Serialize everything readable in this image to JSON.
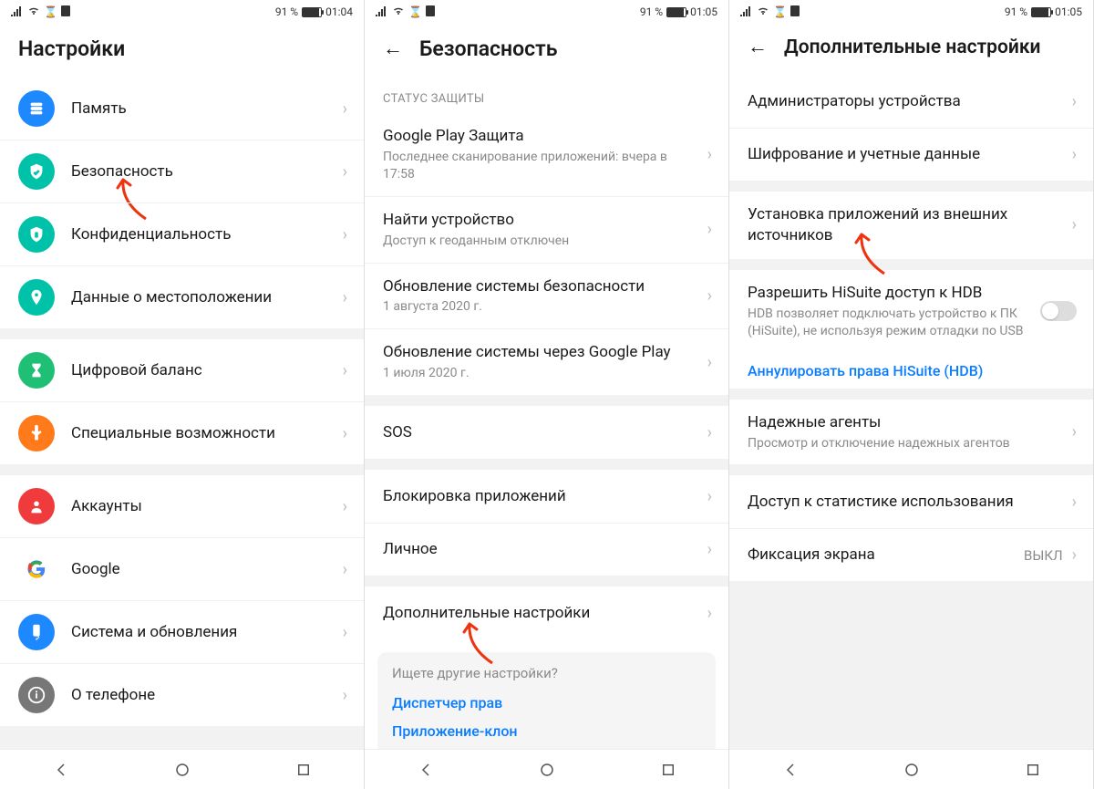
{
  "status": {
    "battery_pct": "91 %",
    "t0": "01:04",
    "t1": "01:05",
    "t2": "01:05"
  },
  "screen1": {
    "title": "Настройки",
    "items": [
      {
        "label": "Память"
      },
      {
        "label": "Безопасность"
      },
      {
        "label": "Конфиденциальность"
      },
      {
        "label": "Данные о местоположении"
      },
      {
        "label": "Цифровой баланс"
      },
      {
        "label": "Специальные возможности"
      },
      {
        "label": "Аккаунты"
      },
      {
        "label": "Google"
      },
      {
        "label": "Система и обновления"
      },
      {
        "label": "О телефоне"
      }
    ]
  },
  "screen2": {
    "title": "Безопасность",
    "section_header": "СТАТУС ЗАЩИТЫ",
    "rows": {
      "play_protect": {
        "title": "Google Play Защита",
        "sub": "Последнее сканирование приложений: вчера в 17:58"
      },
      "find_device": {
        "title": "Найти устройство",
        "sub": "Доступ к геоданным отключен"
      },
      "sec_update": {
        "title": "Обновление системы безопасности",
        "sub": "1 августа 2020 г."
      },
      "gplay_update": {
        "title": "Обновление системы через Google Play",
        "sub": "1 июля 2020 г."
      },
      "sos": {
        "title": "SOS"
      },
      "app_lock": {
        "title": "Блокировка приложений"
      },
      "personal": {
        "title": "Личное"
      },
      "more": {
        "title": "Дополнительные настройки"
      }
    },
    "hint": {
      "title": "Ищете другие настройки?",
      "link1": "Диспетчер прав",
      "link2": "Приложение-клон"
    }
  },
  "screen3": {
    "title": "Дополнительные настройки",
    "rows": {
      "admins": {
        "title": "Администраторы устройства"
      },
      "encrypt": {
        "title": "Шифрование и учетные данные"
      },
      "ext_install": {
        "title": "Установка приложений из внешних источников"
      },
      "hisuite": {
        "title": "Разрешить HiSuite доступ к HDB",
        "sub": "HDB позволяет подключать устройство к ПК (HiSuite), не используя режим отладки по USB"
      },
      "hisuite_revoke": "Аннулировать права HiSuite (HDB)",
      "trusted_agents": {
        "title": "Надежные агенты",
        "sub": "Просмотр и отключение надежных агентов"
      },
      "usage_access": {
        "title": "Доступ к статистике использования"
      },
      "screen_pin": {
        "title": "Фиксация экрана",
        "value": "ВЫКЛ"
      }
    }
  }
}
